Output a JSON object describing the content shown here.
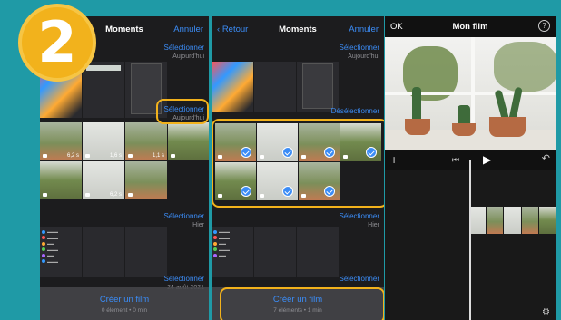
{
  "step_number": "2",
  "panel1": {
    "title": "Moments",
    "right": "Annuler",
    "sections": [
      {
        "action": "Sélectionner",
        "date": "Aujourd'hui"
      },
      {
        "action": "Sélectionner",
        "date": "Aujourd'hui"
      },
      {
        "action": "Sélectionner",
        "date": "Hier"
      },
      {
        "action": "Sélectionner",
        "date": "24 août 2021"
      }
    ],
    "durations": [
      "6,2 s",
      "1,6 s",
      "1,1 s",
      "",
      "",
      "",
      "6,2 s",
      ""
    ],
    "footer_main": "Créer un film",
    "footer_sub": "0 élément • 0 min"
  },
  "panel2": {
    "back": "Retour",
    "title": "Moments",
    "right": "Annuler",
    "sections": [
      {
        "action": "Sélectionner",
        "date": "Aujourd'hui"
      },
      {
        "action": "Désélectionner",
        "date": ""
      },
      {
        "action": "Sélectionner",
        "date": "Hier"
      },
      {
        "action": "Sélectionner",
        "date": ""
      }
    ],
    "footer_main": "Créer un film",
    "footer_sub": "7 éléments • 1 min"
  },
  "panel3": {
    "ok": "OK",
    "title": "Mon film",
    "help": "?"
  },
  "colors": {
    "background": "#1f9aa6",
    "accent": "#3b8cf6",
    "highlight": "#f2b21c"
  },
  "icons": [
    "back-chevron-icon",
    "plus-icon",
    "skip-back-icon",
    "play-icon",
    "undo-icon",
    "settings-icon",
    "help-icon",
    "checkmark-icon",
    "camera-icon"
  ]
}
